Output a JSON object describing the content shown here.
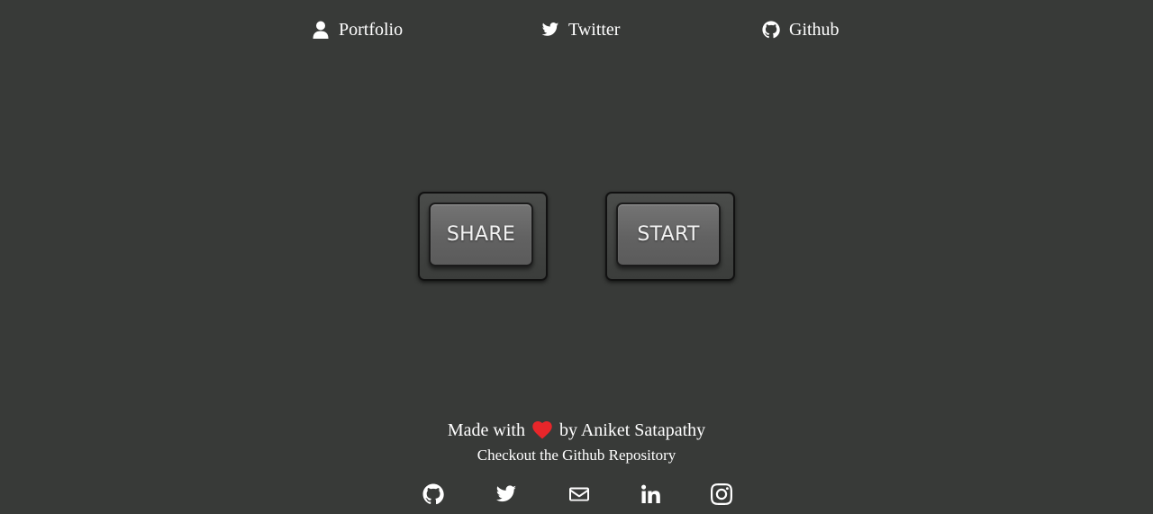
{
  "nav": {
    "items": [
      {
        "label": "Portfolio",
        "icon": "user-icon"
      },
      {
        "label": "Twitter",
        "icon": "twitter-icon"
      },
      {
        "label": "Github",
        "icon": "github-icon"
      }
    ]
  },
  "buttons": {
    "share_label": "SHARE",
    "start_label": "START"
  },
  "footer": {
    "made_with": "Made with",
    "by_text": "by Aniket Satapathy",
    "repo_link": "Checkout the Github Repository",
    "socials": [
      "github-icon",
      "twitter-icon",
      "mail-icon",
      "linkedin-icon",
      "instagram-icon"
    ]
  },
  "colors": {
    "background": "#383a38",
    "heart": "#e8262a",
    "text": "#ffffff"
  }
}
